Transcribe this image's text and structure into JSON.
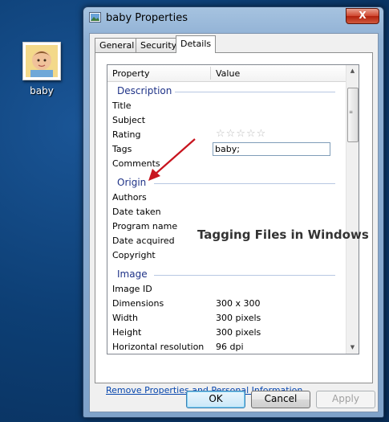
{
  "desktop": {
    "icon_label": "baby"
  },
  "window": {
    "title": "baby Properties",
    "close_glyph": "X",
    "tabs": [
      {
        "label": "General",
        "active": false
      },
      {
        "label": "Security",
        "active": false
      },
      {
        "label": "Details",
        "active": true
      }
    ]
  },
  "list": {
    "header": {
      "property": "Property",
      "value": "Value"
    },
    "groups": {
      "description": {
        "title": "Description",
        "rows": [
          "Title",
          "Subject",
          "Rating",
          "Tags",
          "Comments"
        ],
        "rating_stars": "☆☆☆☆☆",
        "rating_value": 0,
        "tags_value": "baby;"
      },
      "origin": {
        "title": "Origin",
        "rows": [
          "Authors",
          "Date taken",
          "Program name",
          "Date acquired",
          "Copyright"
        ]
      },
      "image": {
        "title": "Image",
        "rows": [
          {
            "prop": "Image ID",
            "val": ""
          },
          {
            "prop": "Dimensions",
            "val": "300 x 300"
          },
          {
            "prop": "Width",
            "val": "300 pixels"
          },
          {
            "prop": "Height",
            "val": "300 pixels"
          },
          {
            "prop": "Horizontal resolution",
            "val": "96 dpi"
          }
        ]
      }
    }
  },
  "overlay_text": "Tagging Files in Windows",
  "remove_link": "Remove Properties and Personal Information",
  "buttons": {
    "ok": "OK",
    "cancel": "Cancel",
    "apply": "Apply"
  },
  "colors": {
    "arrow": "#c8141e",
    "link": "#0645ad",
    "group_header": "#1e3287"
  }
}
